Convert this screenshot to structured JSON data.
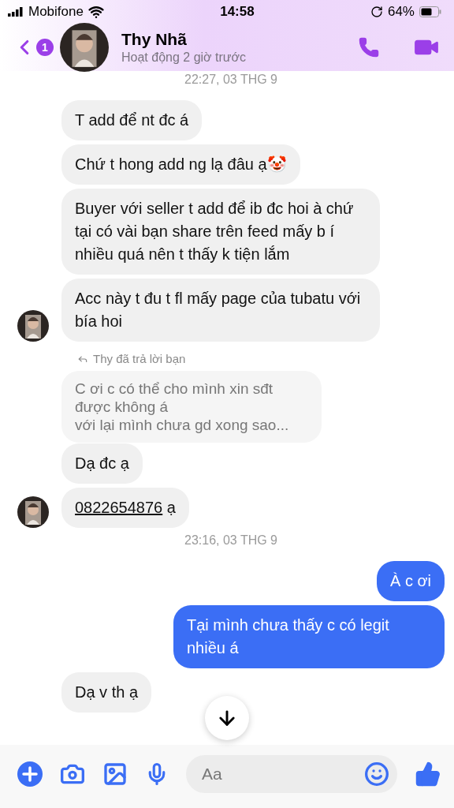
{
  "status_bar": {
    "carrier": "Mobifone",
    "time": "14:58",
    "battery": "64%"
  },
  "header": {
    "back_badge": "1",
    "name": "Thy Nhã",
    "status": "Hoạt động 2 giờ trước"
  },
  "messages": [
    {
      "kind": "timestamp",
      "text": "22:27, 03 THG 9"
    },
    {
      "kind": "incoming",
      "text": "T add để nt đc á",
      "avatar": false
    },
    {
      "kind": "incoming",
      "text": "Chứ t hong add ng lạ đâu ạ🤡",
      "avatar": false
    },
    {
      "kind": "incoming",
      "text": "Buyer với seller t add để ib đc hoi à chứ tại có vài bạn share trên feed mấy b í nhiều quá nên t thấy k tiện lắm",
      "avatar": false
    },
    {
      "kind": "incoming",
      "text": "Acc này t đu t fl mấy page của tubatu với bía hoi",
      "avatar": true
    },
    {
      "kind": "reply_note",
      "text": "Thy đã trả lời bạn"
    },
    {
      "kind": "quoted",
      "text": "C ơi c có thể cho mình xin sđt được không á\nvới lại mình chưa gd xong sao..."
    },
    {
      "kind": "incoming",
      "text": "Dạ đc ạ",
      "avatar": false
    },
    {
      "kind": "incoming",
      "link": "0822654876",
      "text": " ạ",
      "avatar": true
    },
    {
      "kind": "timestamp",
      "text": "23:16, 03 THG 9"
    },
    {
      "kind": "outgoing",
      "text": "À c ơi"
    },
    {
      "kind": "outgoing",
      "text": "Tại mình chưa thấy c có legit nhiều á"
    },
    {
      "kind": "incoming",
      "text": "Dạ v th ạ",
      "avatar": false
    }
  ],
  "composer": {
    "placeholder": "Aa"
  }
}
